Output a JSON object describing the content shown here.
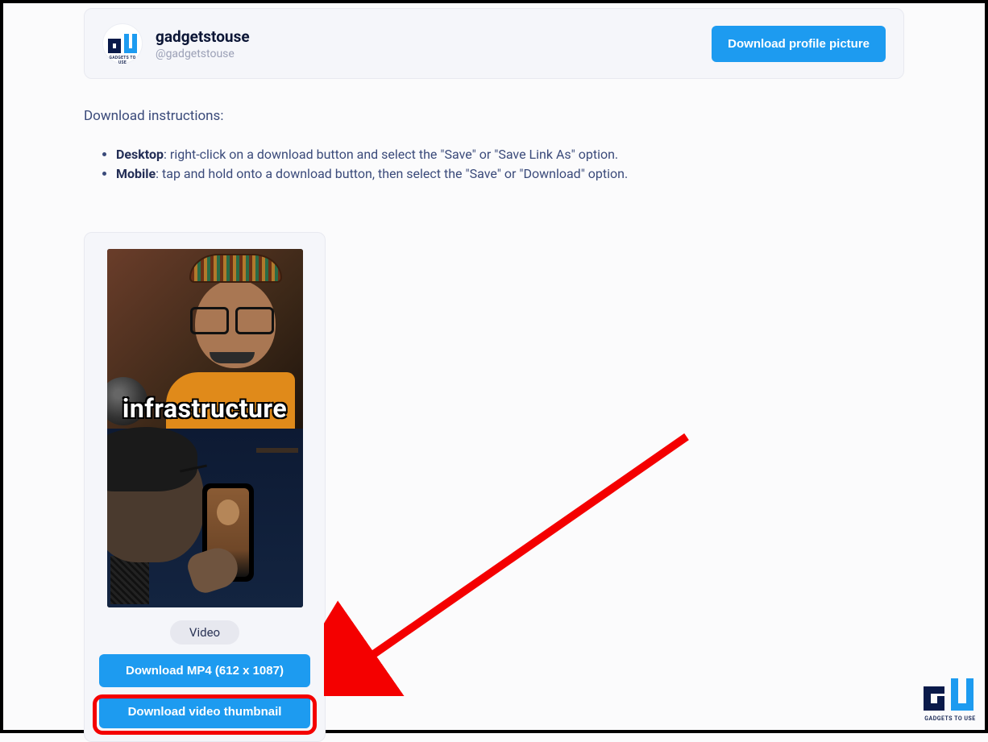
{
  "profile": {
    "name": "gadgetstouse",
    "handle": "@gadgetstouse",
    "avatar_label": "GADGETS TO USE",
    "download_button": "Download profile picture"
  },
  "instructions": {
    "title": "Download instructions:",
    "desktop_label": "Desktop",
    "desktop_text": ": right-click on a download button and select the \"Save\" or \"Save Link As\" option.",
    "mobile_label": "Mobile",
    "mobile_text": ": tap and hold onto a download button, then select the \"Save\" or \"Download\" option."
  },
  "video_card": {
    "thumbnail_caption": "infrastructure",
    "badge": "Video",
    "download_mp4": "Download MP4 (612 x 1087)",
    "download_thumbnail": "Download video thumbnail"
  },
  "watermark": {
    "text": "GADGETS TO USE"
  },
  "colors": {
    "primary": "#1d9bf0",
    "highlight": "#f40000"
  }
}
